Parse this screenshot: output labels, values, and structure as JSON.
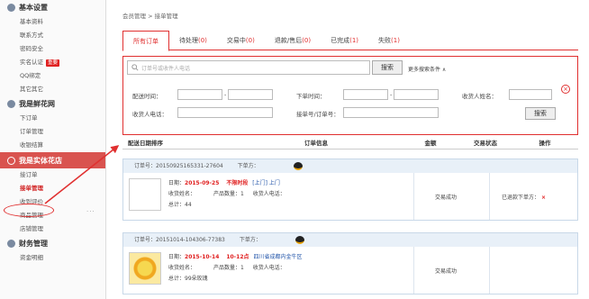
{
  "sidebar": {
    "sections": [
      {
        "title": "基本设置",
        "color": "#7a8aa0",
        "items": [
          "基本资料",
          "联系方式",
          "密码安全",
          "实名认证",
          "QQ绑定",
          "其它其它"
        ],
        "badge_index": 3,
        "badge": "重要"
      },
      {
        "title": "我是鲜花网",
        "color": "#7a8aa0",
        "items": [
          "下订单",
          "订单管理",
          "收银结算"
        ]
      },
      {
        "title": "我是实体花店",
        "color": "#ffffff",
        "active": true,
        "items": [
          "接订单",
          "接单管理",
          "收到评价",
          "商品管理",
          "店铺管理"
        ],
        "selected_index": 1
      },
      {
        "title": "财务管理",
        "color": "#7a8aa0",
        "items": [
          "资金明细"
        ]
      }
    ]
  },
  "breadcrumb": "会员管理 > 接单管理",
  "tabs": [
    {
      "label": "所有订单",
      "count": ""
    },
    {
      "label": "待处理",
      "count": "(0)"
    },
    {
      "label": "交易中",
      "count": "(0)"
    },
    {
      "label": "退款/售后",
      "count": "(0)"
    },
    {
      "label": "已完成",
      "count": "(1)"
    },
    {
      "label": "失败",
      "count": "(1)"
    }
  ],
  "filter": {
    "search_placeholder": "订单号或收件人电话",
    "search_button": "搜索",
    "more_conditions": "更多搜索条件 ∧",
    "label_delivery_time": "配送时间：",
    "label_order_time": "下单时间：",
    "label_recipient_name": "收货人姓名：",
    "label_recipient_phone": "收货人电话：",
    "label_order_no": "接单号/订单号：",
    "submit_button": "搜索",
    "close_symbol": "×"
  },
  "table_headers": [
    "配送日期排序",
    "订单信息",
    "金额",
    "交易状态",
    "操作"
  ],
  "orders": [
    {
      "order_no_label": "订单号：",
      "order_no": "20150925165331-27604",
      "orderer_label": "下单方：",
      "date": "2015-09-25",
      "date_label": "日期：",
      "time_tag": "不限时段",
      "shop_tag": "[上门] 上门",
      "recipient_label": "收货姓名：",
      "qty_label": "产品数量：",
      "qty": "1",
      "phone_label": "收货人电话：",
      "amount_label": "总计：",
      "amount": "44",
      "status": "交易成功",
      "op_text": "已退款下单方：",
      "op_del": "×"
    },
    {
      "order_no_label": "订单号：",
      "order_no": "20151014-104306-77383",
      "orderer_label": "下单方：",
      "date": "2015-10-14",
      "date_label": "日期：",
      "time_tag": "10-12点",
      "shop_tag": "四川省成都内金牛区",
      "recipient_label": "收货姓名：",
      "qty_label": "产品数量：",
      "qty": "1",
      "phone_label": "收货人电话：",
      "amount_label": "总计：",
      "amount": "99朵玫瑰",
      "status": "交易成功",
      "op_text": "",
      "op_del": ""
    }
  ],
  "icons": {
    "search": "search-icon",
    "qq": "qq-icon",
    "close": "close-circle-icon"
  },
  "colors": {
    "accent": "#e03030",
    "sidebar_active": "#d9534f",
    "order_head": "#e8f0f8"
  }
}
